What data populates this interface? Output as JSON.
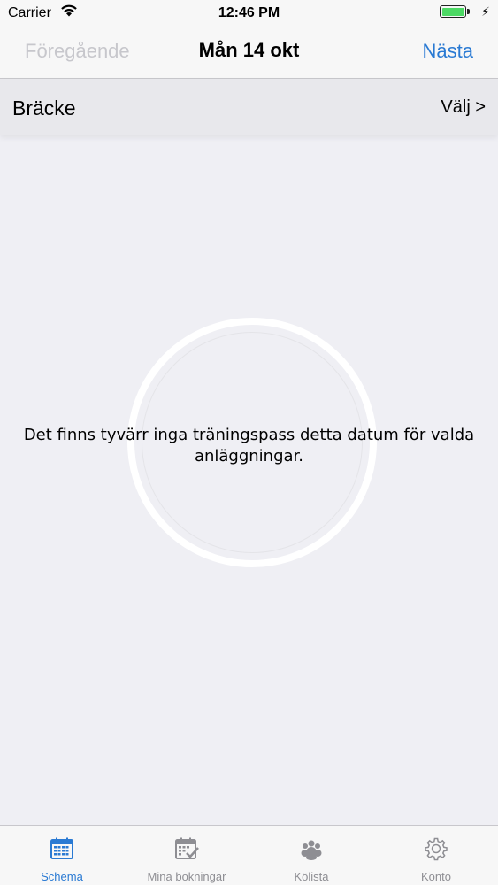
{
  "status_bar": {
    "carrier": "Carrier",
    "time": "12:46 PM"
  },
  "nav": {
    "prev_label": "Föregående",
    "title": "Mån 14 okt",
    "next_label": "Nästa"
  },
  "facility": {
    "name": "Bräcke",
    "choose_label": "Välj >"
  },
  "message": "Det finns tyvärr inga träningspass detta datum för valda anläggningar.",
  "tabs": [
    {
      "label": "Schema",
      "icon": "calendar-icon",
      "active": true
    },
    {
      "label": "Mina bokningar",
      "icon": "calendar-check-icon",
      "active": false
    },
    {
      "label": "Kölista",
      "icon": "group-icon",
      "active": false
    },
    {
      "label": "Konto",
      "icon": "gear-icon",
      "active": false
    }
  ],
  "colors": {
    "accent": "#2a7ad3",
    "inactive": "#8e8e93",
    "disabled": "#c7c7cc",
    "battery": "#4cd964",
    "background": "#efeff4"
  }
}
